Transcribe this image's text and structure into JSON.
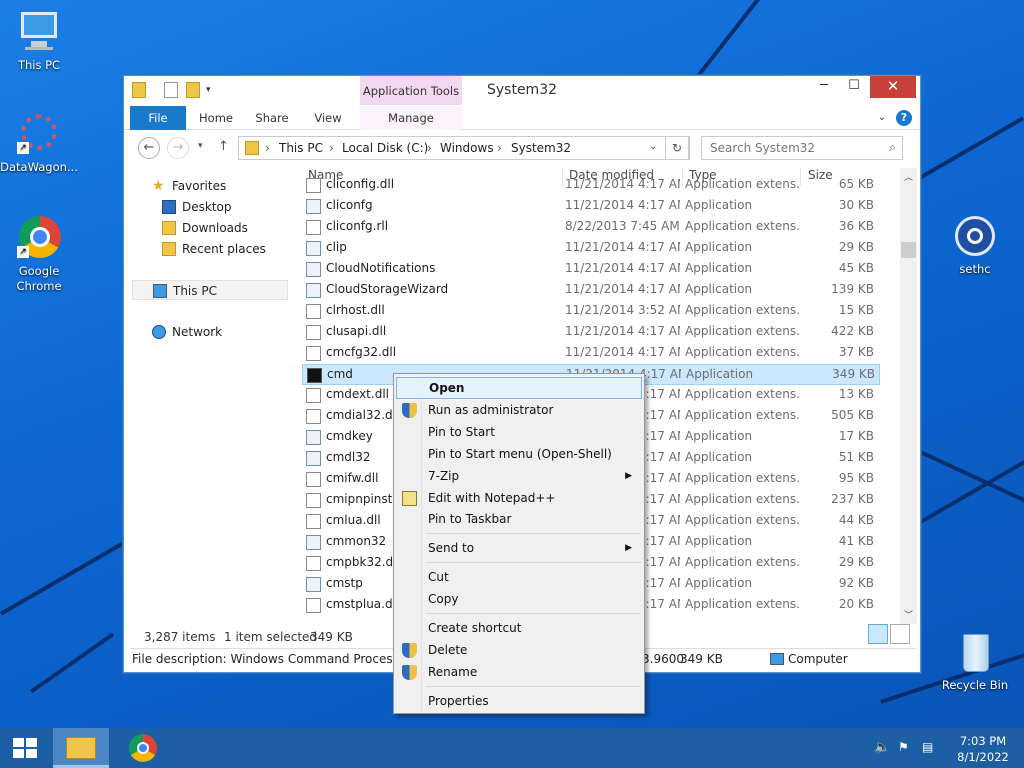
{
  "desktop": {
    "icons": [
      {
        "name": "This PC",
        "icon": "this-pc-icon"
      },
      {
        "name": "DataWagon...",
        "icon": "datawagon-icon"
      },
      {
        "name": "Google Chrome",
        "icon": "chrome-icon"
      },
      {
        "name": "sethc",
        "icon": "accessibility-icon"
      },
      {
        "name": "Recycle Bin",
        "icon": "recycle-bin-icon"
      }
    ]
  },
  "window": {
    "title": "System32",
    "app_tools": "Application Tools",
    "tabs": [
      "File",
      "Home",
      "Share",
      "View",
      "Manage"
    ],
    "help": "?",
    "minimize": "─",
    "maximize": "☐",
    "close": "✕"
  },
  "address": {
    "crumbs": [
      "This PC",
      "Local Disk (C:)",
      "Windows",
      "System32"
    ],
    "search_placeholder": "Search System32"
  },
  "nav": {
    "favorites": "Favorites",
    "desktop": "Desktop",
    "downloads": "Downloads",
    "recent": "Recent places",
    "thispc": "This PC",
    "network": "Network"
  },
  "columns": {
    "name": "Name",
    "date": "Date modified",
    "type": "Type",
    "size": "Size"
  },
  "files": [
    {
      "name": "cliconfig.dll",
      "date": "11/21/2014 4:17 AM",
      "type": "Application extens...",
      "size": "65 KB",
      "icon": "dll-icon"
    },
    {
      "name": "cliconfg",
      "date": "11/21/2014 4:17 AM",
      "type": "Application",
      "size": "30 KB",
      "icon": "app-icon"
    },
    {
      "name": "cliconfg.rll",
      "date": "8/22/2013 7:45 AM",
      "type": "Application extens...",
      "size": "36 KB",
      "icon": "dll-icon"
    },
    {
      "name": "clip",
      "date": "11/21/2014 4:17 AM",
      "type": "Application",
      "size": "29 KB",
      "icon": "app-icon"
    },
    {
      "name": "CloudNotifications",
      "date": "11/21/2014 4:17 AM",
      "type": "Application",
      "size": "45 KB",
      "icon": "app-icon"
    },
    {
      "name": "CloudStorageWizard",
      "date": "11/21/2014 4:17 AM",
      "type": "Application",
      "size": "139 KB",
      "icon": "app-icon"
    },
    {
      "name": "clrhost.dll",
      "date": "11/21/2014 3:52 AM",
      "type": "Application extens...",
      "size": "15 KB",
      "icon": "dll-icon"
    },
    {
      "name": "clusapi.dll",
      "date": "11/21/2014 4:17 AM",
      "type": "Application extens...",
      "size": "422 KB",
      "icon": "dll-icon"
    },
    {
      "name": "cmcfg32.dll",
      "date": "11/21/2014 4:17 AM",
      "type": "Application extens...",
      "size": "37 KB",
      "icon": "dll-icon"
    },
    {
      "name": "cmd",
      "date": "11/21/2014 4:17 AM",
      "type": "Application",
      "size": "349 KB",
      "icon": "cmd-icon"
    },
    {
      "name": "cmdext.dll",
      "date": "11/21/2014 4:17 AM",
      "type": "Application extens...",
      "size": "13 KB",
      "icon": "dll-icon"
    },
    {
      "name": "cmdial32.dll",
      "date": "11/21/2014 4:17 AM",
      "type": "Application extens...",
      "size": "505 KB",
      "icon": "dll-icon"
    },
    {
      "name": "cmdkey",
      "date": "11/21/2014 4:17 AM",
      "type": "Application",
      "size": "17 KB",
      "icon": "app-icon"
    },
    {
      "name": "cmdl32",
      "date": "11/21/2014 4:17 AM",
      "type": "Application",
      "size": "51 KB",
      "icon": "app-icon"
    },
    {
      "name": "cmifw.dll",
      "date": "11/21/2014 4:17 AM",
      "type": "Application extens...",
      "size": "95 KB",
      "icon": "dll-icon"
    },
    {
      "name": "cmipnpinstall.dll",
      "date": "11/21/2014 4:17 AM",
      "type": "Application extens...",
      "size": "237 KB",
      "icon": "dll-icon"
    },
    {
      "name": "cmlua.dll",
      "date": "11/21/2014 4:17 AM",
      "type": "Application extens...",
      "size": "44 KB",
      "icon": "dll-icon"
    },
    {
      "name": "cmmon32",
      "date": "11/21/2014 4:17 AM",
      "type": "Application",
      "size": "41 KB",
      "icon": "app-icon"
    },
    {
      "name": "cmpbk32.dll",
      "date": "11/21/2014 4:17 AM",
      "type": "Application extens...",
      "size": "29 KB",
      "icon": "dll-icon"
    },
    {
      "name": "cmstp",
      "date": "11/21/2014 4:17 AM",
      "type": "Application",
      "size": "92 KB",
      "icon": "app-icon"
    },
    {
      "name": "cmstplua.dll",
      "date": "11/21/2014 4:17 AM",
      "type": "Application extens...",
      "size": "20 KB",
      "icon": "dll-icon"
    }
  ],
  "status": {
    "items": "3,287 items",
    "selected": "1 item selected",
    "size": "349 KB"
  },
  "details": {
    "description": "File description: Windows Command Processor, C",
    "tail": "3.9600",
    "size": "349 KB",
    "location": "Computer"
  },
  "menu": {
    "items": [
      "Open",
      "Run as administrator",
      "Pin to Start",
      "Pin to Start menu (Open-Shell)",
      "7-Zip",
      "Edit with Notepad++",
      "Pin to Taskbar",
      "Send to",
      "Cut",
      "Copy",
      "Create shortcut",
      "Delete",
      "Rename",
      "Properties"
    ]
  },
  "taskbar": {
    "time": "7:03 PM",
    "date": "8/1/2022"
  }
}
